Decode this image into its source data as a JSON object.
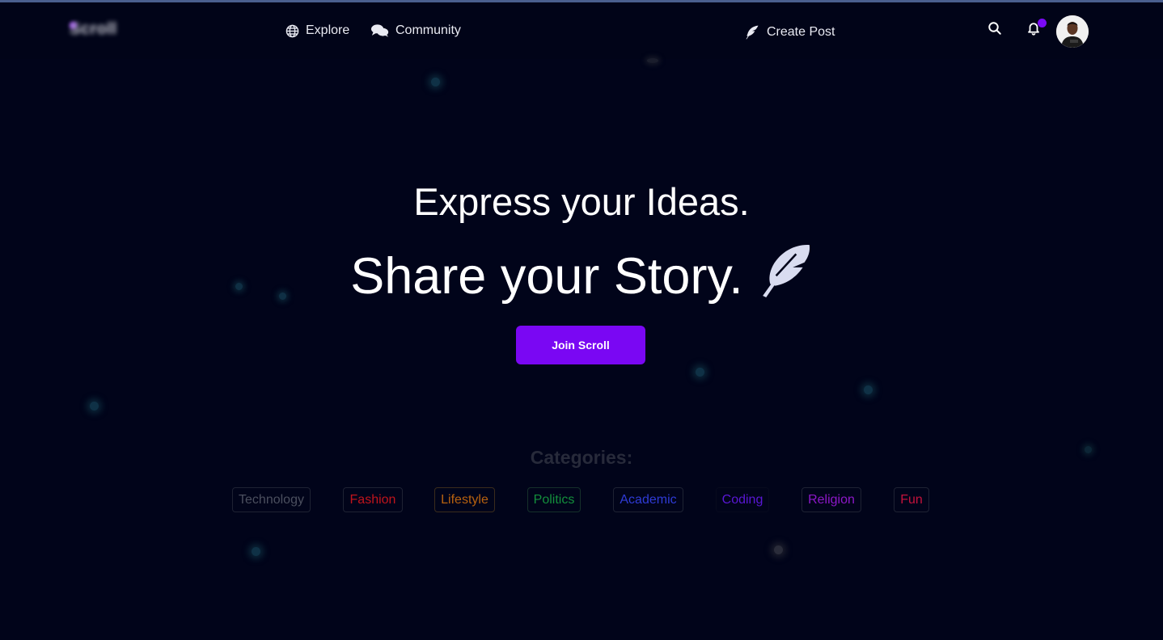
{
  "nav": {
    "logo_text": "Scroll",
    "explore_label": "Explore",
    "community_label": "Community",
    "create_post_label": "Create Post",
    "search_icon": "search-icon",
    "bell_icon": "bell-icon",
    "avatar_icon": "user-avatar"
  },
  "hero": {
    "line1": "Express your Ideas.",
    "line2": "Share your Story.",
    "feather_icon": "feather-icon",
    "join_label": "Join Scroll"
  },
  "categories": {
    "title": "Categories:",
    "items": [
      {
        "label": "Technology",
        "color": "#4b4f5e"
      },
      {
        "label": "Fashion",
        "color": "#c0141c"
      },
      {
        "label": "Lifestyle",
        "color": "#b8620f"
      },
      {
        "label": "Politics",
        "color": "#138f3c"
      },
      {
        "label": "Academic",
        "color": "#2f3bd6"
      },
      {
        "label": "Coding",
        "color": "#5a17d6"
      },
      {
        "label": "Religion",
        "color": "#8d18c9"
      },
      {
        "label": "Fun",
        "color": "#c4123c"
      }
    ]
  },
  "colors": {
    "background": "#01041a",
    "accent": "#7a07f3",
    "notification": "#7a0af5"
  }
}
